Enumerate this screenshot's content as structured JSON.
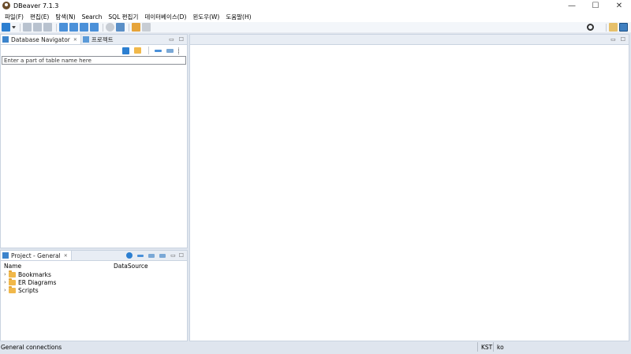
{
  "window": {
    "title": "DBeaver 7.1.3",
    "minimize_glyph": "—",
    "maximize_glyph": "☐",
    "close_glyph": "✕"
  },
  "menu": [
    "파일(F)",
    "편집(E)",
    "탐색(N)",
    "Search",
    "SQL 편집기",
    "데이터베이스(D)",
    "윈도우(W)",
    "도움말(H)"
  ],
  "navigator": {
    "tabs": [
      {
        "label": "Database Navigator",
        "icon": "database-navigator-icon"
      },
      {
        "label": "프로젝트",
        "icon": "project-icon"
      }
    ],
    "search_placeholder": "Enter a part of table name here"
  },
  "project_panel": {
    "tab_label": "Project - General",
    "columns": [
      "Name",
      "DataSource"
    ],
    "items": [
      {
        "label": "Bookmarks",
        "icon": "bookmarks-folder-icon"
      },
      {
        "label": "ER Diagrams",
        "icon": "er-diagrams-folder-icon"
      },
      {
        "label": "Scripts",
        "icon": "scripts-folder-icon"
      }
    ]
  },
  "status": {
    "left": "General connections",
    "timezone": "KST",
    "locale": "ko"
  },
  "colors": {
    "accent": "#2c7fd1",
    "background": "#dfe5ee",
    "folder": "#f1b84a"
  }
}
